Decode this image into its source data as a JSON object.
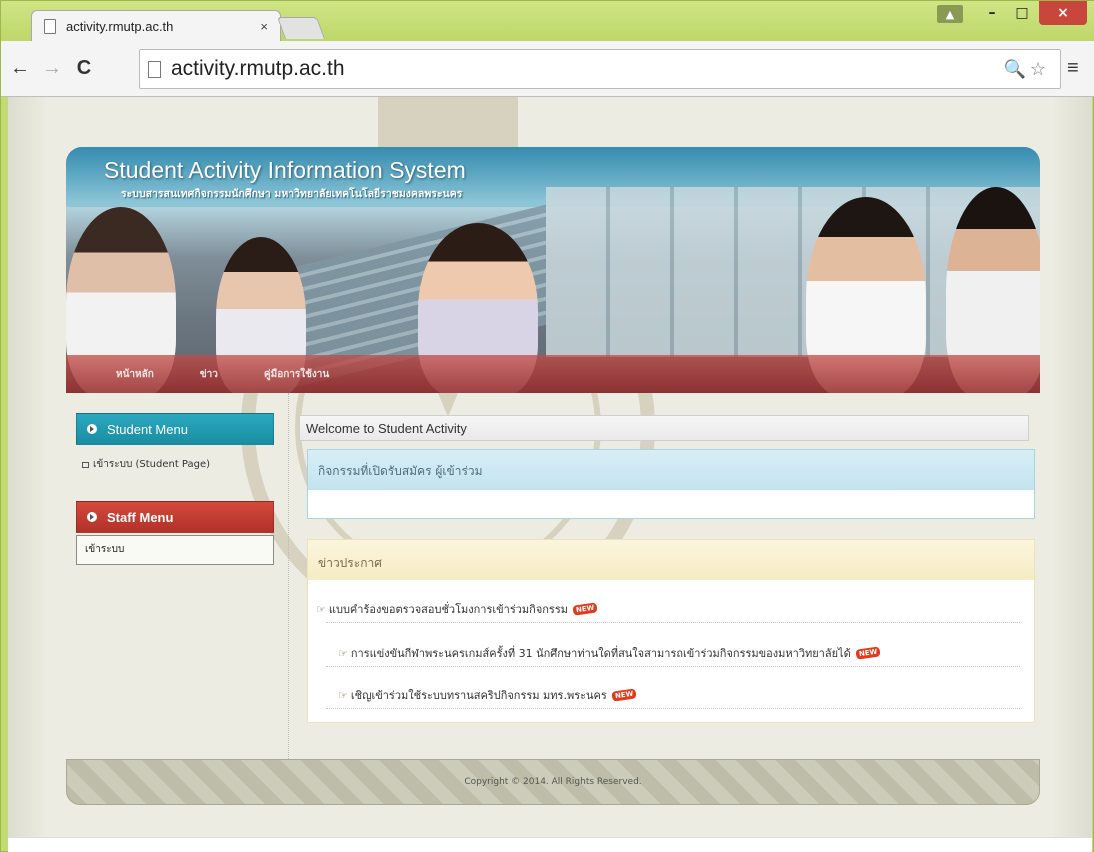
{
  "browser": {
    "tab_title": "activity.rmutp.ac.th",
    "tab_close": "×",
    "url": "activity.rmutp.ac.th",
    "back_glyph": "←",
    "forward_glyph": "→",
    "reload_glyph": "C",
    "omnibox_tools": "🔍☆",
    "menu_glyph": "≡",
    "window_buttons": {
      "user": "▲",
      "minimize": "–",
      "maximize": "□",
      "close": "×"
    }
  },
  "banner": {
    "title": "Student Activity Information System",
    "subtitle": "ระบบสารสนเทศกิจกรรมนักศึกษา มหาวิทยาลัยเทคโนโลยีราชมงคลพระนคร",
    "nav": [
      "หน้าหลัก",
      "ข่าว",
      "คู่มือการใช้งาน"
    ]
  },
  "sidebar": {
    "student_menu": "Student Menu",
    "student_link": "เข้าระบบ (Student Page)",
    "staff_menu": "Staff Menu",
    "staff_link": "เข้าระบบ"
  },
  "main": {
    "welcome": "Welcome to Student Activity",
    "open_activities_title": "กิจกรรมที่เปิดรับสมัคร ผู้เข้าร่วม",
    "news_title": "ข่าวประกาศ",
    "news_items": [
      "แบบคำร้องขอตรวจสอบชั่วโมงการเข้าร่วมกิจกรรม",
      "การแข่งขันกีฬาพระนครเกมส์ครั้งที่ 31 นักศึกษาท่านใดที่สนใจสามารถเข้าร่วมกิจกรรมของมหาวิทยาลัยได้",
      "เชิญเข้าร่วมใช้ระบบทรานสคริปกิจกรรม มทร.พระนคร"
    ],
    "news_arrow": "☞",
    "new_badge": "NEW"
  },
  "footer": {
    "copyright": "Copyright © 2014. All Rights Reserved."
  },
  "colors": {
    "student_menu": "#1b8ea3",
    "staff_menu": "#b3302b",
    "chrome": "#c3dc72"
  }
}
